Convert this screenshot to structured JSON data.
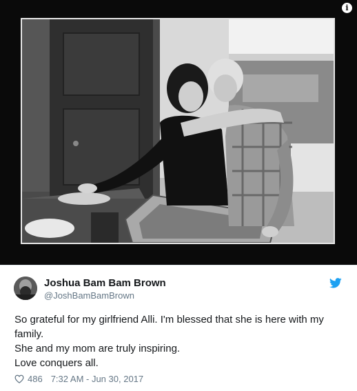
{
  "tweet": {
    "display_name": "Joshua Bam Bam Brown",
    "handle": "@JoshBamBamBrown",
    "lines": [
      "So grateful for my girlfriend Alli. I'm blessed that she is here with my family.",
      "She and my mom are truly inspiring.",
      "Love conquers all."
    ],
    "like_count": "486",
    "timestamp": "7:32 AM - Jun 30, 2017"
  },
  "photo": {
    "info_label": "i"
  },
  "icons": {
    "info": "info-icon",
    "brand": "twitter-bird-icon",
    "like": "heart-icon"
  },
  "colors": {
    "twitter_blue": "#1da1f2",
    "frame": "#0a0a0a",
    "secondary_text": "#657786"
  }
}
